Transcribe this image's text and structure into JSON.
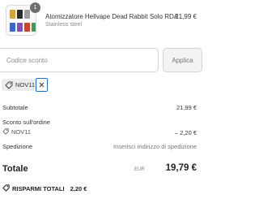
{
  "product": {
    "quantity": "1",
    "title": "Atomizzatore Hellvape Dead Rabbit Solo RDA",
    "variant": "Stainless steel",
    "price": "21,99 €"
  },
  "discount": {
    "placeholder": "Codice sconto",
    "apply_label": "Applica",
    "applied_code": "NOV11"
  },
  "summary": {
    "subtotal_label": "Subtotale",
    "subtotal_value": "21,99 €",
    "order_discount_label": "Sconto sull'ordine",
    "code_label": "NOV11",
    "code_value": "– 2,20 €",
    "shipping_label": "Spedizione",
    "shipping_value": "Inserisci indirizzo di spedizione"
  },
  "total": {
    "label": "Totale",
    "currency": "EUR",
    "value": "19,79 €"
  },
  "savings": {
    "label": "RISPARMI TOTALI",
    "value": "2,20 €"
  },
  "colors": {
    "focus_blue": "#1a73c9",
    "tag_bg": "#ececec",
    "button_bg": "#f3f3f3"
  },
  "icons": [
    "product-thumbnail",
    "tag-icon",
    "close-icon",
    "tag-icon-small",
    "savings-tag-icon"
  ]
}
